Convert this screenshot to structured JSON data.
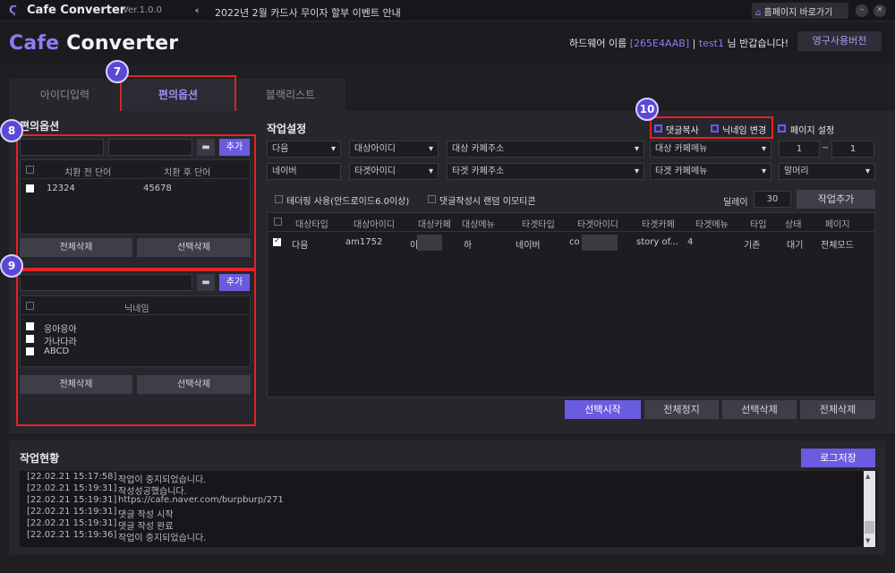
{
  "titlebar": {
    "app_name": "Cafe Converter",
    "version": "Ver.1.0.0",
    "notice": "2022년 2월 카드사 무이자 할부 이벤트 안내",
    "home_button": "홈페이지 바로가기",
    "minimize": "–",
    "close": "×"
  },
  "header": {
    "brand_cafe": "Cafe",
    "brand_converter": " Converter",
    "greeting_prefix": "하드웨어 이름 ",
    "hw_id": "[265E4AAB]",
    "sep": " | ",
    "user": "test1",
    "greeting_suffix": " 님 반갑습니다!",
    "perm_button": "영구사용버전"
  },
  "tabs": [
    "아이디입력",
    "편의옵션",
    "블랙리스트"
  ],
  "callouts": [
    "7",
    "8",
    "9",
    "10"
  ],
  "left": {
    "title": "편의옵션",
    "replace": {
      "add_button": "추가",
      "col_before": "치환 전 단어",
      "col_after": "치환 후 단어",
      "rows": [
        {
          "before": "12324",
          "after": "45678"
        }
      ],
      "delete_all": "전체삭제",
      "delete_selected": "선택삭제"
    },
    "nickname": {
      "add_button": "추가",
      "col_header": "닉네임",
      "items": [
        "응아응아",
        "가나다라",
        "ABCD"
      ],
      "delete_all": "전체삭제",
      "delete_selected": "선택삭제"
    }
  },
  "work": {
    "title": "작업설정",
    "options": {
      "comment_copy": "댓글복사",
      "nickname_change": "닉네임 변경",
      "page_setting": "페이지 설정"
    },
    "row1": {
      "source": "다음",
      "source_id": "대상아이디",
      "source_cafe": "대상 카페주소",
      "source_menu": "대상 카페메뉴",
      "page_from": "1",
      "tilde": "~",
      "page_to": "1"
    },
    "row2": {
      "target": "네이버",
      "target_id": "타겟아이디",
      "target_cafe": "타겟 카페주소",
      "target_menu": "타겟 카페메뉴",
      "prefix": "말머리"
    },
    "tethering": "테더링 사용(안드로이드6.0이상)",
    "random_emoticon": "댓글작성시 랜덤 이모티콘",
    "delay_label": "딜레이",
    "delay_value": "30",
    "add_task": "작업추가",
    "columns": [
      "대상타입",
      "대상아이디",
      "대상카페",
      "대상메뉴",
      "타겟타입",
      "타겟아이디",
      "타겟카페",
      "타겟메뉴",
      "타입",
      "상태",
      "페이지"
    ],
    "rows": [
      {
        "src_type": "다음",
        "src_id": "am1752",
        "src_cafe": "이",
        "src_menu": "하",
        "tgt_type": "네이버",
        "tgt_id": "co",
        "tgt_cafe": "story of...",
        "tgt_menu": "4",
        "type": "기존",
        "status": "대기",
        "page": "전체모드"
      }
    ],
    "buttons": {
      "start_selected": "선택시작",
      "stop_all": "전체정지",
      "delete_selected": "선택삭제",
      "delete_all": "전체삭제"
    }
  },
  "status": {
    "title": "작업현황",
    "save_log": "로그저장",
    "logs": [
      {
        "time": "[22.02.21 15:17:58]",
        "msg": "작업이 중지되었습니다."
      },
      {
        "time": "[22.02.21 15:19:31]",
        "msg": "작성성공했습니다."
      },
      {
        "time": "[22.02.21 15:19:31]",
        "msg": "https://cafe.naver.com/burpburp/271"
      },
      {
        "time": "[22.02.21 15:19:31]",
        "msg": "댓글 작성 시작"
      },
      {
        "time": "[22.02.21 15:19:31]",
        "msg": "댓글 작성 완료"
      },
      {
        "time": "[22.02.21 15:19:36]",
        "msg": "작업이 중지되었습니다."
      }
    ]
  },
  "colors": {
    "accent": "#6a5ce0",
    "callout_border": "#e02424",
    "background": "#1e1e23"
  }
}
